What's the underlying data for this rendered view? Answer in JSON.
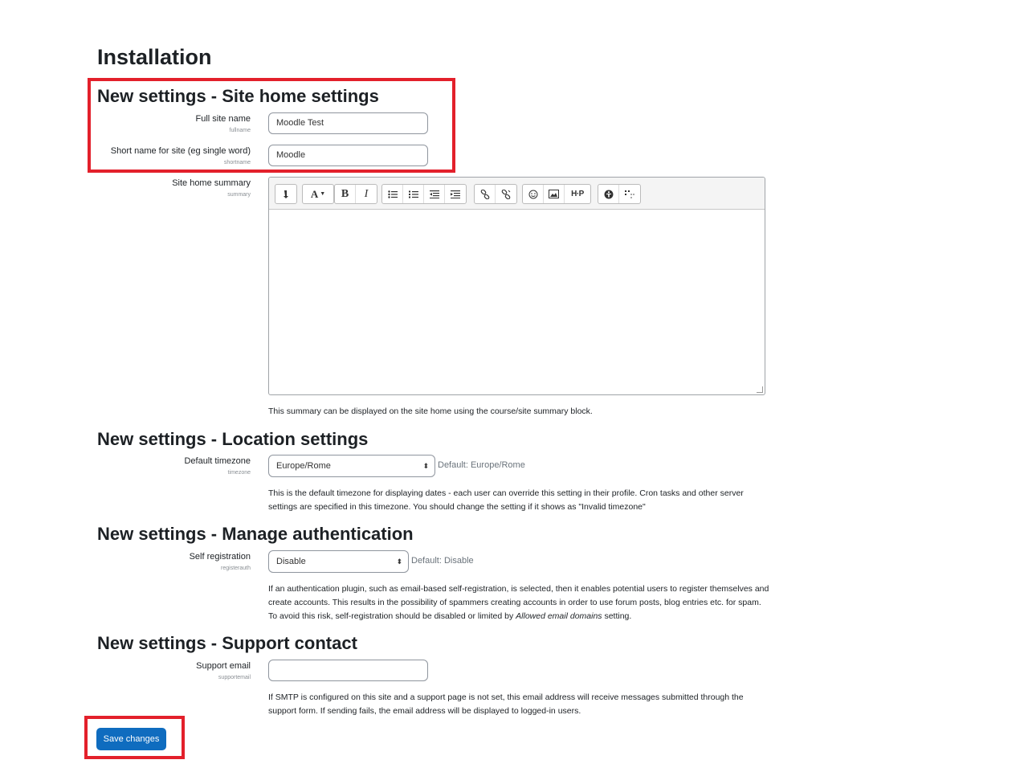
{
  "page_title": "Installation",
  "sections": {
    "site_home": {
      "heading": "New settings - Site home settings",
      "fullname": {
        "label": "Full site name",
        "key": "fullname",
        "value": "Moodle Test"
      },
      "shortname": {
        "label": "Short name for site (eg single word)",
        "key": "shortname",
        "value": "Moodle"
      },
      "summary": {
        "label": "Site home summary",
        "key": "summary",
        "value": "",
        "description": "This summary can be displayed on the site home using the course/site summary block."
      }
    },
    "location": {
      "heading": "New settings - Location settings",
      "timezone": {
        "label": "Default timezone",
        "key": "timezone",
        "value": "Europe/Rome",
        "default": "Default: Europe/Rome",
        "description": "This is the default timezone for displaying dates - each user can override this setting in their profile. Cron tasks and other server settings are specified in this timezone. You should change the setting if it shows as \"Invalid timezone\""
      }
    },
    "auth": {
      "heading": "New settings - Manage authentication",
      "registerauth": {
        "label": "Self registration",
        "key": "registerauth",
        "value": "Disable",
        "default": "Default: Disable",
        "description_pre": "If an authentication plugin, such as email-based self-registration, is selected, then it enables potential users to register themselves and create accounts. This results in the possibility of spammers creating accounts in order to use forum posts, blog entries etc. for spam. To avoid this risk, self-registration should be disabled or limited by ",
        "description_em": "Allowed email domains",
        "description_post": " setting."
      }
    },
    "support": {
      "heading": "New settings - Support contact",
      "supportemail": {
        "label": "Support email",
        "key": "supportemail",
        "value": "",
        "description": "If SMTP is configured on this site and a support page is not set, this email address will receive messages submitted through the support form. If sending fails, the email address will be displayed to logged-in users."
      }
    }
  },
  "editor_toolbar": {
    "groups": [
      [
        "collapse-icon"
      ],
      [
        "text-style-icon"
      ],
      [
        "bold-icon",
        "italic-icon"
      ],
      [
        "unordered-list-icon",
        "ordered-list-icon",
        "outdent-icon",
        "indent-icon"
      ],
      [
        "link-icon",
        "unlink-icon"
      ],
      [
        "emoji-icon",
        "image-icon",
        "h5p-icon"
      ],
      [
        "accessibility-checker-icon",
        "screenreader-helper-icon"
      ]
    ]
  },
  "save_button": "Save changes",
  "colors": {
    "accent": "#0f6cbf",
    "highlight": "#e3202b"
  }
}
